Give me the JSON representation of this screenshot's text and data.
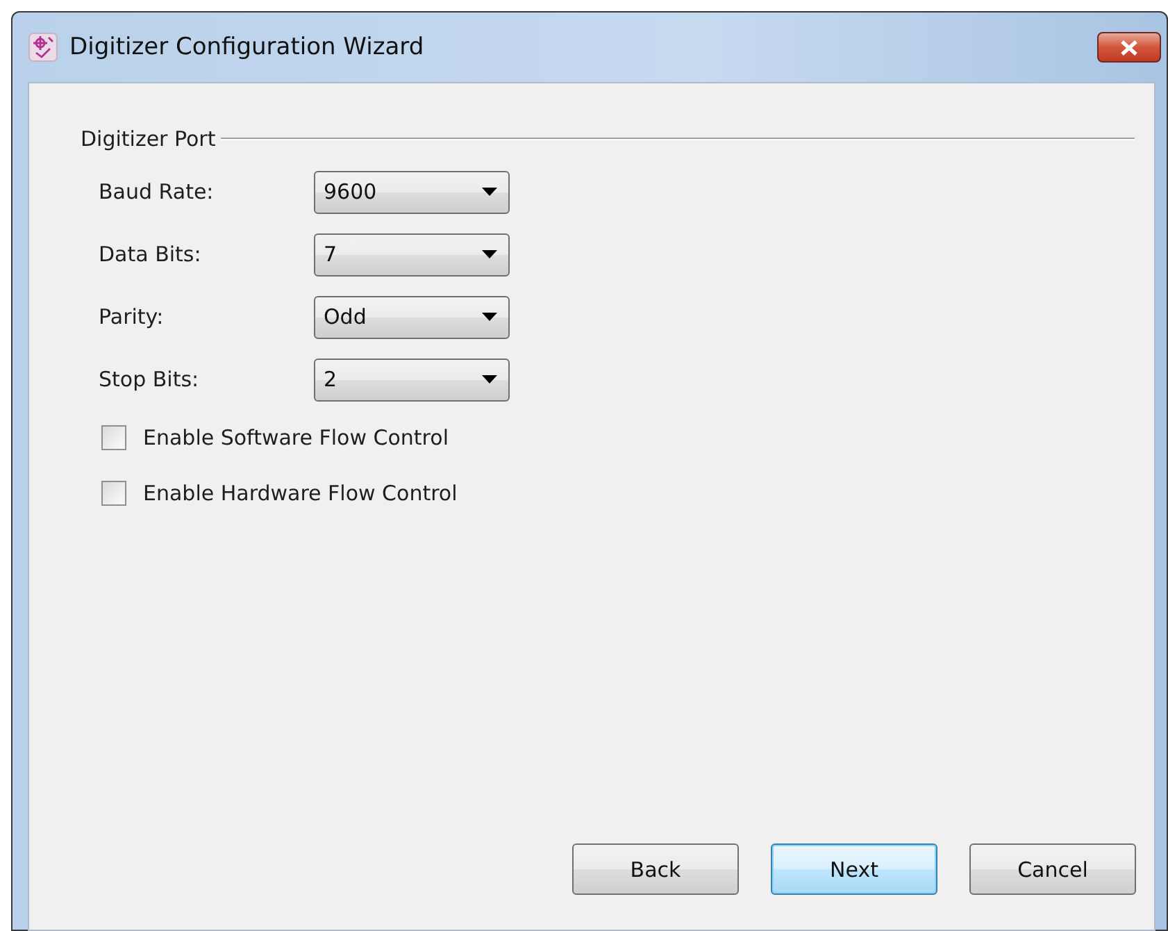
{
  "window": {
    "title": "Digitizer Configuration Wizard"
  },
  "group": {
    "title": "Digitizer Port"
  },
  "fields": [
    {
      "label": "Baud Rate:",
      "value": "9600"
    },
    {
      "label": "Data Bits:",
      "value": "7"
    },
    {
      "label": "Parity:",
      "value": "Odd"
    },
    {
      "label": "Stop Bits:",
      "value": "2"
    }
  ],
  "checkboxes": [
    {
      "label": "Enable Software Flow Control",
      "checked": false
    },
    {
      "label": "Enable Hardware Flow Control",
      "checked": false
    }
  ],
  "buttons": [
    {
      "label": "Back",
      "default": false
    },
    {
      "label": "Next",
      "default": true
    },
    {
      "label": "Cancel",
      "default": false
    }
  ]
}
